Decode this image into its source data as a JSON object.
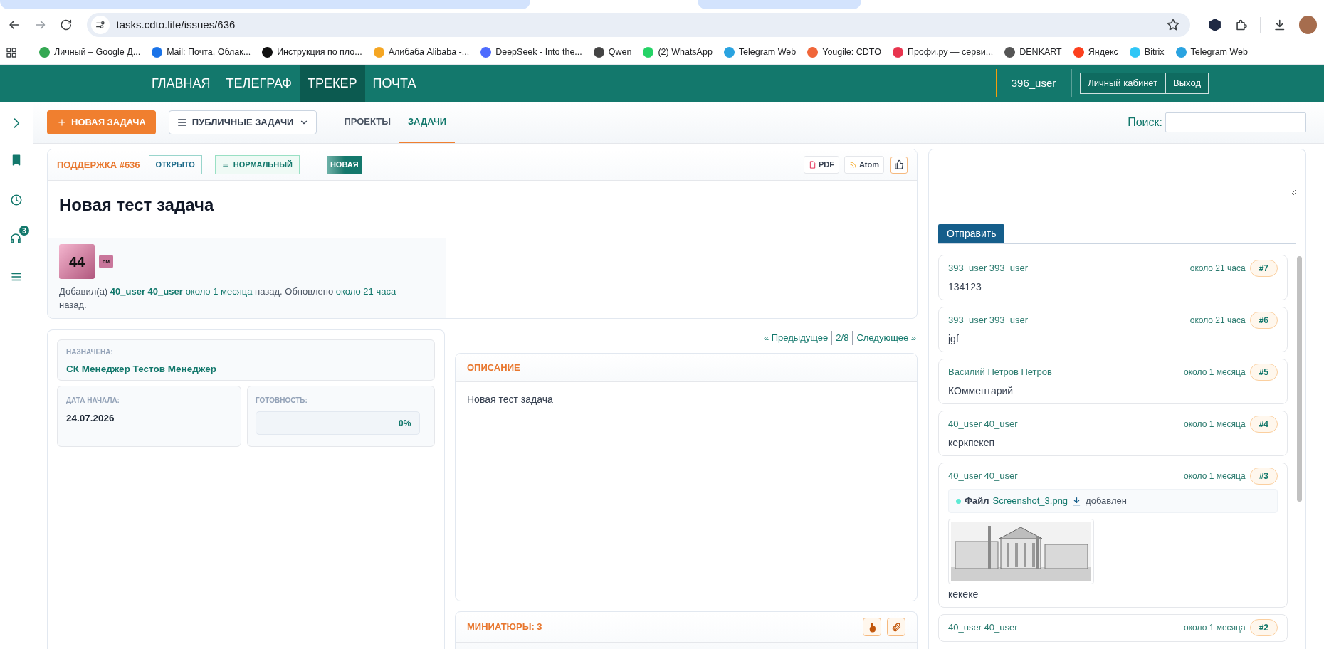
{
  "browser": {
    "url": "tasks.cdto.life/issues/636",
    "bookmarks": [
      {
        "label": "Личный – Google Д...",
        "color": "#34a853"
      },
      {
        "label": "Mail: Почта, Облак...",
        "color": "#1a73e8"
      },
      {
        "label": "Инструкция по пло...",
        "color": "#111111"
      },
      {
        "label": "Алибаба Alibaba -...",
        "color": "#f5a623"
      },
      {
        "label": "DeepSeek - Into the...",
        "color": "#4d6bfe"
      },
      {
        "label": "Qwen",
        "color": "#444444"
      },
      {
        "label": "(2) WhatsApp",
        "color": "#25d366"
      },
      {
        "label": "Telegram Web",
        "color": "#2aa3e0"
      },
      {
        "label": "Yougile: CDTO",
        "color": "#f0663a"
      },
      {
        "label": "Профи.ру — серви...",
        "color": "#e8344e"
      },
      {
        "label": "DENKART",
        "color": "#555555"
      },
      {
        "label": "Яндекс",
        "color": "#fc3f1d"
      },
      {
        "label": "Bitrix",
        "color": "#2fc6f6"
      },
      {
        "label": "Telegram Web",
        "color": "#2aa3e0"
      }
    ]
  },
  "nav": {
    "items": [
      {
        "label": "ГЛАВНАЯ",
        "selected": false
      },
      {
        "label": "ТЕЛЕГРАФ",
        "selected": false
      },
      {
        "label": "ТРЕКЕР",
        "selected": true
      },
      {
        "label": "ПОЧТА",
        "selected": false
      }
    ],
    "user": "396_user",
    "buttons": [
      "Личный кабинет",
      "Выход"
    ]
  },
  "sidebar": {
    "badge": "3"
  },
  "toolbar": {
    "new_task": "НОВАЯ ЗАДАЧА",
    "filter": "ПУБЛИЧНЫЕ ЗАДАЧИ",
    "tabs": [
      {
        "label": "ПРОЕКТЫ",
        "selected": false
      },
      {
        "label": "ЗАДАЧИ",
        "selected": true
      }
    ],
    "search_label": "Поиск:"
  },
  "issue": {
    "tracker": "ПОДДЕРЖКА #636",
    "status": "ОТКРЫТО",
    "priority": "НОРМАЛЬНЫЙ",
    "state": "НОВАЯ",
    "exports": [
      "PDF",
      "Atom"
    ],
    "title": "Новая тест задача",
    "avatar": "44",
    "avatar_badge": "см",
    "meta": [
      {
        "kind": "text",
        "text": "Добавил(а) "
      },
      {
        "kind": "user",
        "text": "40_user 40_user"
      },
      {
        "kind": "time",
        "text": "около 1 месяца"
      },
      {
        "kind": "text",
        "text": " назад. Обновлено "
      },
      {
        "kind": "time",
        "text": "около 21 часа"
      },
      {
        "kind": "text",
        "text": " назад."
      }
    ],
    "assigned_label": "НАЗНАЧЕНА:",
    "assigned": "СК Менеджер Тестов Менеджер",
    "start_label": "ДАТА НАЧАЛА:",
    "start": "24.07.2026",
    "done_label": "ГОТОВНОСТЬ:",
    "done": {
      "level": 0,
      "reading": "0%"
    }
  },
  "pager": {
    "prev": "« Предыдущее",
    "position": "2/8",
    "next": "Следующее »"
  },
  "description": {
    "title": "ОПИСАНИЕ",
    "text": "Новая тест задача"
  },
  "thumbnails": {
    "title": "МИНИАТЮРЫ: 3"
  },
  "comment_form": {
    "button": "Отправить"
  },
  "comments": [
    {
      "kind": "text",
      "author": "393_user 393_user",
      "time": "около 21 часа",
      "number": "#7",
      "text": "134123"
    },
    {
      "kind": "text",
      "author": "393_user 393_user",
      "time": "около 21 часа",
      "number": "#6",
      "text": "jgf"
    },
    {
      "kind": "text",
      "author": "Василий Петров Петров",
      "time": "около 1 месяца",
      "number": "#5",
      "text": "КОмментарий"
    },
    {
      "kind": "text",
      "author": "40_user 40_user",
      "time": "около 1 месяца",
      "number": "#4",
      "text": "керкпекеп"
    },
    {
      "kind": "file",
      "author": "40_user 40_user",
      "time": "около 1 месяца",
      "number": "#3",
      "file_label": "Файл",
      "file_name": "Screenshot_3.png",
      "file_suffix": "добавлен",
      "text": "кекеке"
    },
    {
      "kind": "text",
      "author": "40_user 40_user",
      "time": "около 1 месяца",
      "number": "#2"
    }
  ]
}
